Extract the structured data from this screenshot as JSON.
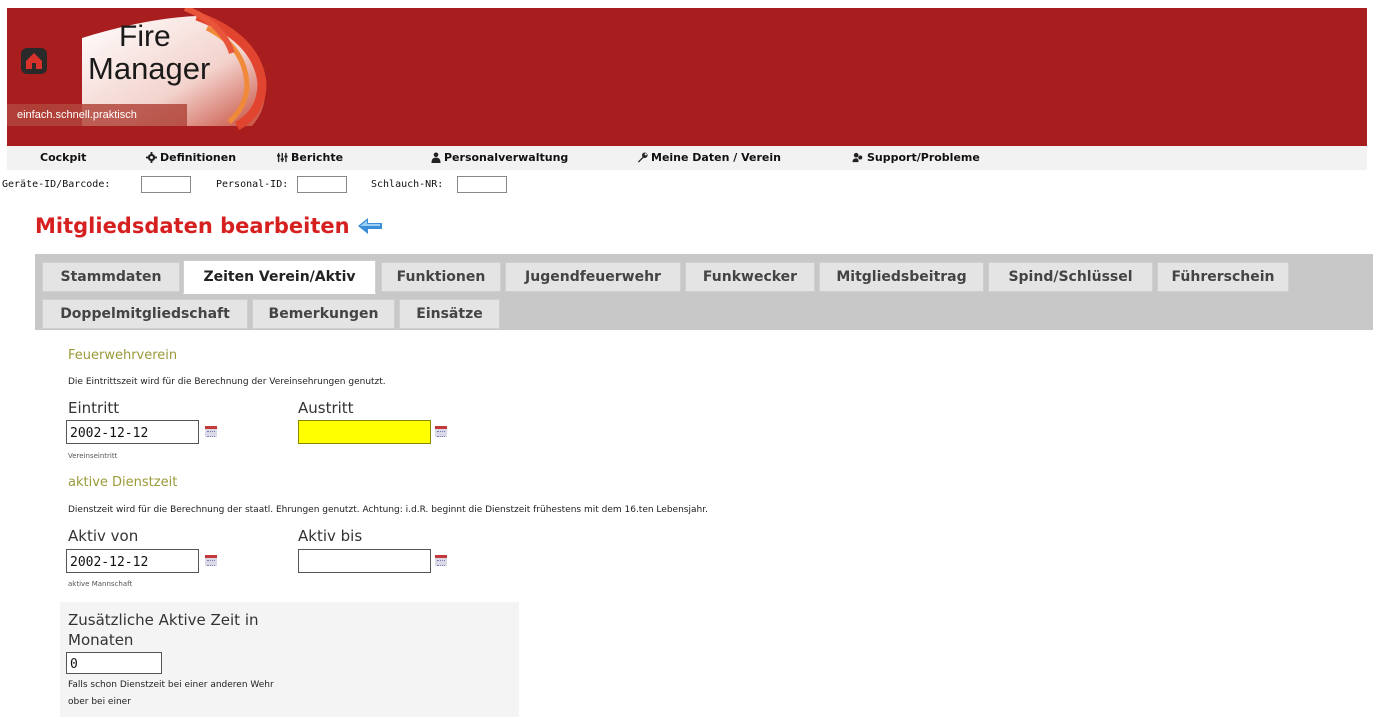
{
  "header": {
    "logo_line1": "Fire",
    "logo_line2": "Manager",
    "tagline": "einfach.schnell.praktisch"
  },
  "nav": {
    "items": [
      {
        "label": "Cockpit",
        "icon": ""
      },
      {
        "label": "Definitionen",
        "icon": "gear-icon"
      },
      {
        "label": "Berichte",
        "icon": "sliders-icon"
      },
      {
        "label": "Personalverwaltung",
        "icon": "person-icon"
      },
      {
        "label": "Meine Daten / Verein",
        "icon": "wrench-icon"
      },
      {
        "label": "Support/Probleme",
        "icon": "users-icon"
      }
    ]
  },
  "quick": {
    "geraete_label": "Geräte-ID/Barcode:",
    "personal_label": "Personal-ID:",
    "schlauch_label": "Schlauch-NR:"
  },
  "page": {
    "title": "Mitgliedsdaten bearbeiten"
  },
  "tabs": [
    {
      "label": "Stammdaten",
      "active": false
    },
    {
      "label": "Zeiten Verein/Aktiv",
      "active": true
    },
    {
      "label": "Funktionen",
      "active": false
    },
    {
      "label": "Jugendfeuerwehr",
      "active": false
    },
    {
      "label": "Funkwecker",
      "active": false
    },
    {
      "label": "Mitgliedsbeitrag",
      "active": false
    },
    {
      "label": "Spind/Schlüssel",
      "active": false
    },
    {
      "label": "Führerschein",
      "active": false
    },
    {
      "label": "Doppelmitgliedschaft",
      "active": false
    },
    {
      "label": "Bemerkungen",
      "active": false
    },
    {
      "label": "Einsätze",
      "active": false
    }
  ],
  "verein": {
    "title": "Feuerwehrverein",
    "desc": "Die Eintrittszeit wird für die Berechnung der Vereinsehrungen genutzt.",
    "eintritt_label": "Eintritt",
    "eintritt_value": "2002-12-12",
    "eintritt_hint": "Vereinseintritt",
    "austritt_label": "Austritt",
    "austritt_value": ""
  },
  "aktiv": {
    "title": "aktive Dienstzeit",
    "desc": "Dienstzeit wird für die Berechnung der staatl. Ehrungen genutzt. Achtung: i.d.R. beginnt die Dienstzeit frühestens mit dem 16.ten Lebensjahr.",
    "von_label": "Aktiv von",
    "von_value": "2002-12-12",
    "von_hint": "aktive Mannschaft",
    "bis_label": "Aktiv bis",
    "bis_value": ""
  },
  "extra": {
    "label": "Zusätzliche Aktive Zeit in Monaten",
    "value": "0",
    "hint": "Falls schon Dienstzeit bei einer anderen Wehr ober bei einer"
  },
  "colors": {
    "header_bg": "#a81d1d",
    "title_red": "#d62020",
    "section_olive": "#9a9a3a",
    "highlight_yellow": "#ffff00"
  }
}
